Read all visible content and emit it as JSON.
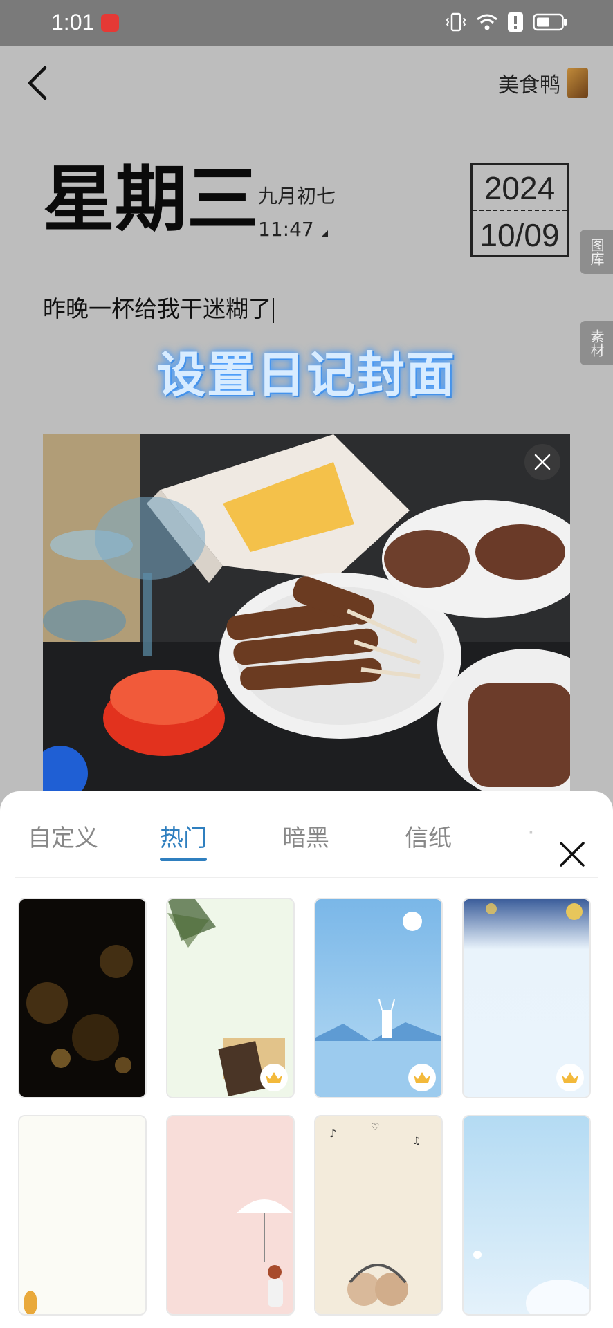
{
  "status": {
    "time": "1:01"
  },
  "header": {
    "author_name": "美食鸭"
  },
  "date": {
    "weekday": "星期三",
    "lunar": "九月初七",
    "time": "11:47",
    "year": "2024",
    "month_day": "10/09"
  },
  "side_tabs": [
    {
      "label": "图库"
    },
    {
      "label": "素材"
    }
  ],
  "entry": {
    "text": "昨晚一杯给我干迷糊了"
  },
  "overlay": {
    "title": "设置日记封面"
  },
  "sheet": {
    "tabs": [
      {
        "label": "自定义"
      },
      {
        "label": "热门"
      },
      {
        "label": "暗黑"
      },
      {
        "label": "信纸"
      }
    ],
    "selected_tab": "热门"
  },
  "colors": {
    "accent": "#2f7fbf",
    "overlay_title_glow": "#56a4ff"
  },
  "icons": {
    "back": "chevron-left-icon",
    "close": "close-icon",
    "premium": "crown-icon"
  }
}
